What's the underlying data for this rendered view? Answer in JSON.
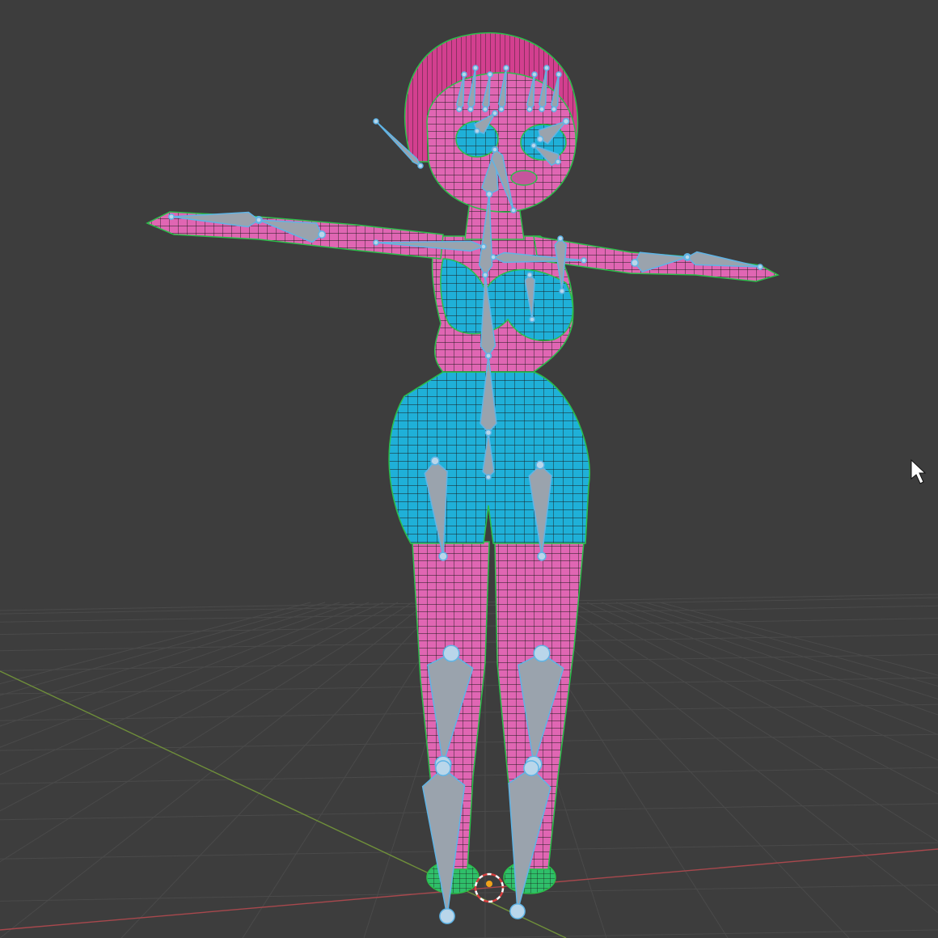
{
  "viewport": {
    "background": "#3d3d3d",
    "grid_color": "#4a4a4a",
    "x_axis_color": "#a8484d",
    "y_axis_color": "#6f8f3a"
  },
  "scene": {
    "skin_color": "#e066b3",
    "suit_color": "#1fb0d8",
    "hair_color": "#d33f8f",
    "shoe_color": "#2fbf6a",
    "wire_color": "#1a1a1a",
    "outline_color": "#2bbf4a"
  },
  "armature": {
    "bone_fill": "#9aa3ad",
    "bone_outline": "#5fb4e6",
    "joint_color": "#b9d6ea"
  },
  "icons": {
    "cursor": "mouse-cursor-icon",
    "origin": "3d-cursor-icon"
  }
}
